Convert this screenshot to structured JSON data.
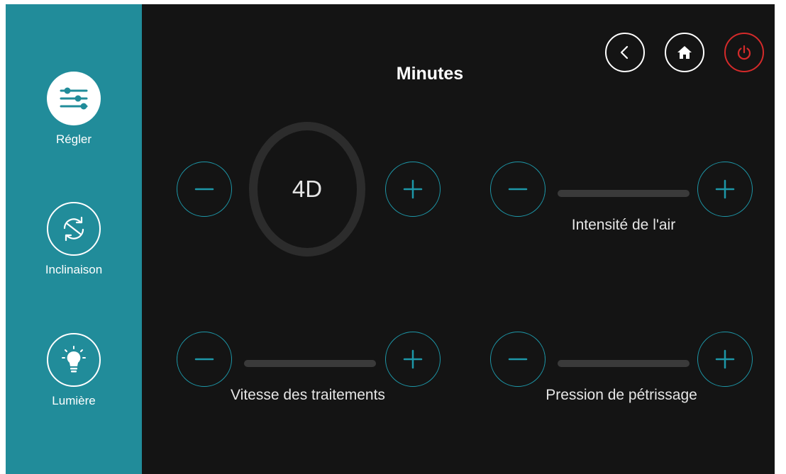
{
  "sidebar": {
    "items": [
      {
        "label": "Régler",
        "icon": "sliders-icon",
        "active": true
      },
      {
        "label": "Inclinaison",
        "icon": "sync-arrows-icon",
        "active": false
      },
      {
        "label": "Lumière",
        "icon": "lightbulb-icon",
        "active": false
      }
    ]
  },
  "header": {
    "title": "Minutes",
    "buttons": [
      {
        "name": "back-button",
        "icon": "chevron-left-icon"
      },
      {
        "name": "home-button",
        "icon": "home-icon"
      },
      {
        "name": "power-button",
        "icon": "power-icon"
      }
    ]
  },
  "controls": {
    "mode": {
      "value": "4D"
    },
    "air_intensity": {
      "label": "Intensité de l'air",
      "level": 0
    },
    "treatment_speed": {
      "label": "Vitesse des traitements",
      "level": 0
    },
    "kneading_pressure": {
      "label": "Pression de pétrissage",
      "level": 0
    }
  },
  "colors": {
    "sidebar": "#218c9a",
    "background": "#141414",
    "accent": "#1d97a8",
    "power": "#d42a2a",
    "track": "#3a3a3a"
  }
}
